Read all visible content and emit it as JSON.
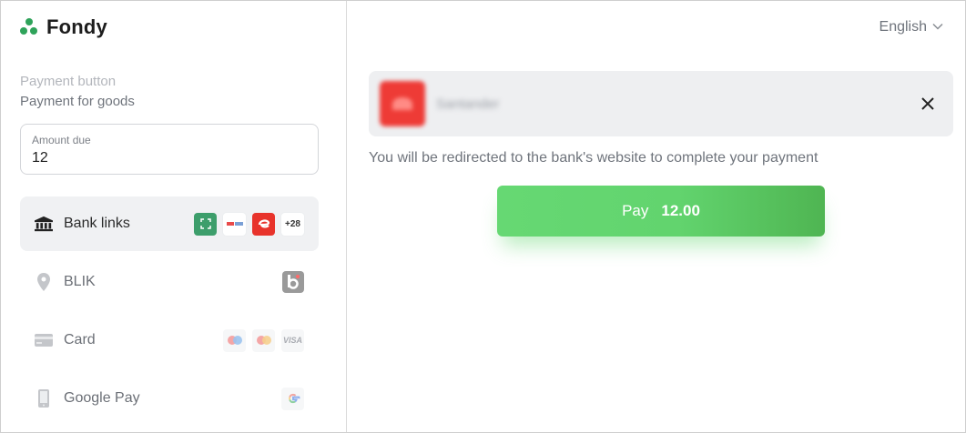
{
  "brand": {
    "name": "Fondy",
    "color": "#2fa35a"
  },
  "merchant": {
    "label": "Payment button",
    "description": "Payment for goods"
  },
  "amount": {
    "label": "Amount due",
    "value": "12"
  },
  "methods": [
    {
      "label": "Bank links",
      "icon": "bank-icon",
      "badges": [
        "bank-badge-green",
        "bank-badge-white",
        "bank-badge-red"
      ],
      "more": "+28",
      "active": true
    },
    {
      "label": "BLIK",
      "icon": "location-pin-icon",
      "badges": [
        "blik-icon"
      ]
    },
    {
      "label": "Card",
      "icon": "card-icon",
      "badges": [
        "maestro-icon",
        "mastercard-icon",
        "visa-icon"
      ],
      "visa_text": "VISA"
    },
    {
      "label": "Google Pay",
      "icon": "phone-icon",
      "badges": [
        "google-icon"
      ]
    }
  ],
  "language": {
    "selected": "English"
  },
  "bank": {
    "name": "Santander"
  },
  "redirect_message": "You will be redirected to the bank's website to complete your payment",
  "pay": {
    "label": "Pay",
    "amount": "12.00",
    "color": "#66d873"
  }
}
